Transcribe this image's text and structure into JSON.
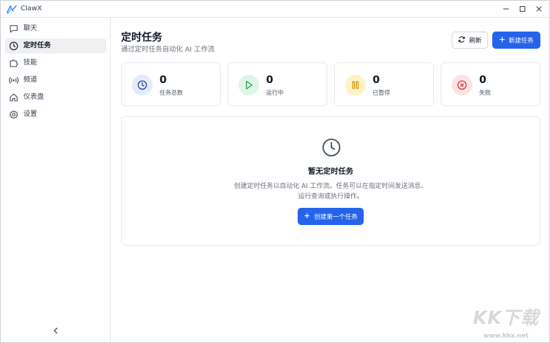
{
  "app": {
    "title": "ClawX"
  },
  "sidebar": {
    "items": [
      {
        "label": "聊天",
        "icon": "chat-bubble-icon",
        "active": false
      },
      {
        "label": "定时任务",
        "icon": "clock-icon",
        "active": true
      },
      {
        "label": "技能",
        "icon": "puzzle-icon",
        "active": false
      },
      {
        "label": "频道",
        "icon": "radio-signal-icon",
        "active": false
      },
      {
        "label": "仪表盘",
        "icon": "home-icon",
        "active": false
      },
      {
        "label": "设置",
        "icon": "gear-icon",
        "active": false
      }
    ]
  },
  "header": {
    "title": "定时任务",
    "subtitle": "通过定时任务自动化 AI 工作流",
    "refresh_label": "刷新",
    "new_task_label": "新建任务"
  },
  "stats": [
    {
      "value": "0",
      "label": "任务总数",
      "color": "#2563eb",
      "bg": "#e3ecfb",
      "icon": "clock-icon"
    },
    {
      "value": "0",
      "label": "运行中",
      "color": "#16a34a",
      "bg": "#dff5e7",
      "icon": "play-icon"
    },
    {
      "value": "0",
      "label": "已暂停",
      "color": "#ca8a04",
      "bg": "#fdf3c7",
      "icon": "pause-icon"
    },
    {
      "value": "0",
      "label": "失败",
      "color": "#dc2626",
      "bg": "#fde3e3",
      "icon": "x-circle-icon"
    }
  ],
  "empty_state": {
    "title": "暂无定时任务",
    "description": "创建定时任务以自动化 AI 工作流。任务可以在指定时间发送消息、运行查询或执行操作。",
    "button_label": "创建第一个任务"
  },
  "watermark": {
    "text": "KK下载",
    "url": "www.kkx.net"
  },
  "colors": {
    "accent": "#2563eb",
    "border": "#e5e7eb",
    "active_bg": "#eef0f2"
  }
}
